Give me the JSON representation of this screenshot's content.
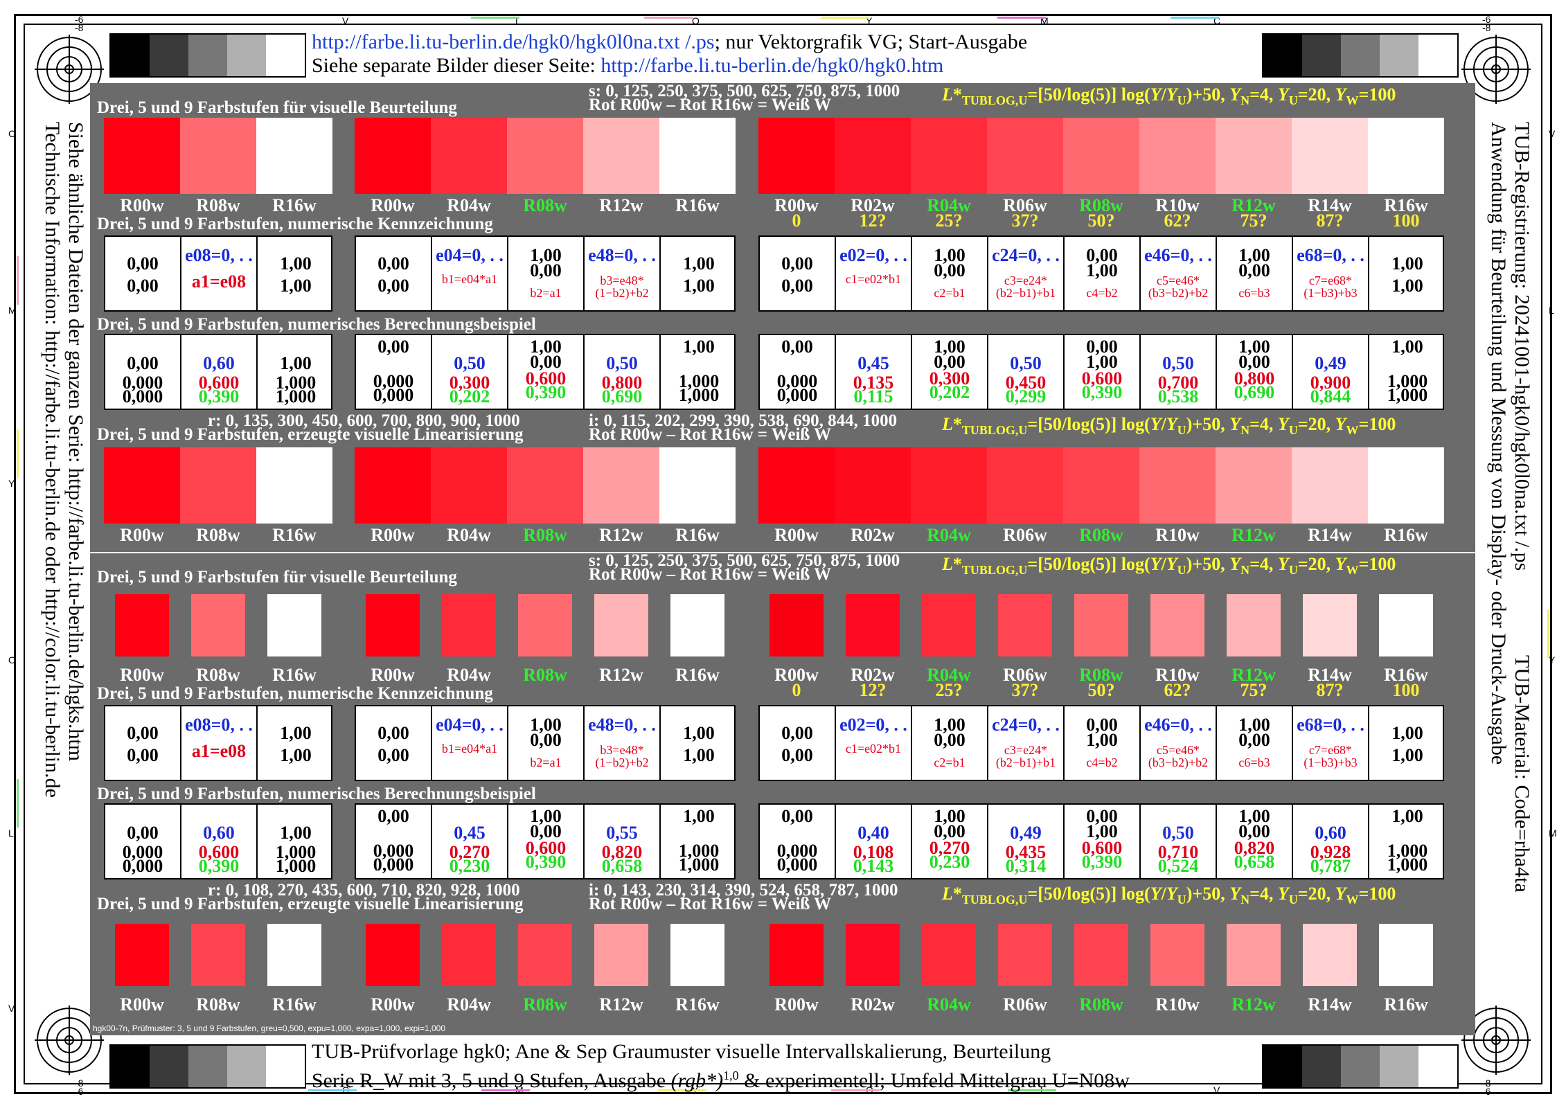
{
  "header": {
    "line1_link": "http://farbe.li.tu-berlin.de/hgk0/hgk0l0na.txt /.ps",
    "line1_rest": "; nur Vektorgrafik VG; Start-Ausgabe",
    "line2_text": "Siehe separate Bilder dieser Seite: ",
    "line2_link": "http://farbe.li.tu-berlin.de/hgk0/hgk0.htm"
  },
  "footer": {
    "line1": "TUB-Prüfvorlage hgk0; Ane & Sep Graumuster visuelle Intervallskalierung, Beurteilung",
    "line2_a": "Serie R_W mit 3, 5 und 9 Stufen, Ausgabe ",
    "line2_rgb": "(rgb*)",
    "line2_sup": "1,0",
    "line2_b": " & experimentell; Umfeld Mittelgrau U=N08w"
  },
  "left_side": {
    "line1": "Siehe ähnliche Dateien der ganzen Serie: http://farbe.li.tu-berlin.de/hgks.htm",
    "line2": "Technische Information: http://farbe.li.tu-berlin.de oder http://color.li.tu-berlin.de"
  },
  "right_side": {
    "line1": "TUB-Registrierung: 20241001-hgk0/hgk0l0na.txt /.ps",
    "line2": "Anwendung für Beurteilung und Messung von Display- oder Druck-Ausgabe",
    "line3": "TUB-Material: Code=rha4ta"
  },
  "edge_letters": {
    "top": [
      "V",
      "L",
      "O",
      "Y",
      "M",
      "C"
    ],
    "top_num_a": "-6",
    "top_num_b": "-8",
    "left": [
      "C",
      "M",
      "Y",
      "O",
      "L",
      "V"
    ],
    "right": [
      "V",
      "L",
      "Y",
      "M"
    ]
  },
  "sections": {
    "visual": "Drei, 5 und 9 Farbstufen für visuelle Beurteilung",
    "numkenn": "Drei, 5 und 9 Farbstufen, numerische Kennzeichnung",
    "berech": "Drei, 5 und 9 Farbstufen, numerisches Berechnungsbeispiel",
    "linear": "Drei, 5 und 9 Farbstufen, erzeugte visuelle Linearisierung",
    "svalues": "s: 0, 125, 250, 375, 500, 625, 750, 875, 1000",
    "rot": "Rot R00w – Rot R16w = Weiß W",
    "formula": "L*TUBLOG,U=[50/log(5)] log(Y/YU)+50, YN=4, YU=20, YW=100",
    "r_top": "r: 0, 135, 300, 450, 600, 700, 800, 900, 1000",
    "i_top": "i: 0, 115, 202, 299, 390, 538, 690, 844, 1000",
    "r_bot": "r: 0, 108, 270, 435, 600, 710, 820, 928, 1000",
    "i_bot": "i: 0, 143, 230, 314, 390, 524, 658, 787, 1000",
    "tiny": "hgk00-7n, Prüfmuster: 3, 5 und 9 Farbstufen, greu=0,500, expu=1,000, expa=1,000, expi=1,000"
  },
  "labels3": [
    "R00w",
    "R08w",
    "R16w"
  ],
  "labels5": [
    "R00w",
    "R04w",
    "R08w",
    "R12w",
    "R16w"
  ],
  "labels9": [
    "R00w",
    "R02w",
    "R04w",
    "R06w",
    "R08w",
    "R10w",
    "R12w",
    "R14w",
    "R16w"
  ],
  "nums9": [
    "0",
    "12?",
    "25?",
    "37?",
    "50?",
    "62?",
    "75?",
    "87?",
    "100"
  ],
  "kenn3": [
    [
      "0,00",
      "0,00"
    ],
    [
      "e08=0, . .",
      "a1=e08"
    ],
    [
      "1,00",
      "1,00"
    ]
  ],
  "kenn5": [
    [
      "0,00",
      "0,00"
    ],
    [
      "e04=0, . .",
      "b1=e04*a1"
    ],
    [
      "1,00",
      "0,00",
      "b2=a1"
    ],
    [
      "e48=0, . .",
      "b3=e48*",
      "(1−b2)+b2"
    ],
    [
      "1,00",
      "1,00"
    ]
  ],
  "kenn9": [
    [
      "0,00",
      "0,00"
    ],
    [
      "e02=0, . .",
      "c1=e02*b1"
    ],
    [
      "1,00",
      "0,00",
      "c2=b1"
    ],
    [
      "c24=0, . .",
      "c3=e24*",
      "(b2−b1)+b1"
    ],
    [
      "0,00",
      "1,00",
      "c4=b2"
    ],
    [
      "e46=0, . .",
      "c5=e46*",
      "(b3−b2)+b2"
    ],
    [
      "1,00",
      "0,00",
      "c6=b3"
    ],
    [
      "e68=0, . .",
      "c7=e68*",
      "(1−b3)+b3"
    ],
    [
      "1,00",
      "1,00"
    ]
  ],
  "ber_top": {
    "b3": [
      [
        "0,00",
        "0,000",
        "0,000"
      ],
      [
        "0,60",
        "0,600",
        "0,390"
      ],
      [
        "1,00",
        "1,000",
        "1,000"
      ]
    ],
    "b5": [
      [
        "0,00",
        "",
        "0,000",
        "0,000"
      ],
      [
        "0,50",
        "",
        "0,300",
        "0,202"
      ],
      [
        "1,00",
        "0,00",
        "0,600",
        "0,390"
      ],
      [
        "0,50",
        "",
        "0,800",
        "0,690"
      ],
      [
        "1,00",
        "",
        "1,000",
        "1,000"
      ]
    ],
    "b9": [
      [
        "0,00",
        "",
        "0,000",
        "0,000"
      ],
      [
        "0,45",
        "",
        "0,135",
        "0,115"
      ],
      [
        "1,00",
        "0,00",
        "0,300",
        "0,202"
      ],
      [
        "0,50",
        "",
        "0,450",
        "0,299"
      ],
      [
        "0,00",
        "1,00",
        "0,600",
        "0,390"
      ],
      [
        "0,50",
        "",
        "0,700",
        "0,538"
      ],
      [
        "1,00",
        "0,00",
        "0,800",
        "0,690"
      ],
      [
        "0,49",
        "",
        "0,900",
        "0,844"
      ],
      [
        "1,00",
        "",
        "1,000",
        "1,000"
      ]
    ]
  },
  "ber_bot": {
    "b3": [
      [
        "0,00",
        "0,000",
        "0,000"
      ],
      [
        "0,60",
        "0,600",
        "0,390"
      ],
      [
        "1,00",
        "1,000",
        "1,000"
      ]
    ],
    "b5": [
      [
        "0,00",
        "",
        "0,000",
        "0,000"
      ],
      [
        "0,45",
        "",
        "0,270",
        "0,230"
      ],
      [
        "1,00",
        "0,00",
        "0,600",
        "0,390"
      ],
      [
        "0,55",
        "",
        "0,820",
        "0,658"
      ],
      [
        "1,00",
        "",
        "1,000",
        "1,000"
      ]
    ],
    "b9": [
      [
        "0,00",
        "",
        "0,000",
        "0,000"
      ],
      [
        "0,40",
        "",
        "0,108",
        "0,143"
      ],
      [
        "1,00",
        "0,00",
        "0,270",
        "0,230"
      ],
      [
        "0,49",
        "",
        "0,435",
        "0,314"
      ],
      [
        "0,00",
        "1,00",
        "0,600",
        "0,390"
      ],
      [
        "0,50",
        "",
        "0,710",
        "0,524"
      ],
      [
        "1,00",
        "0,00",
        "0,820",
        "0,658"
      ],
      [
        "0,60",
        "",
        "0,928",
        "0,787"
      ],
      [
        "1,00",
        "",
        "1,000",
        "1,000"
      ]
    ]
  },
  "colors": {
    "panel": "#6b6b6b",
    "link": "#1a3fd6",
    "yellow": "#ffff33",
    "green": "#33ee33",
    "s3": [
      "#fe0011",
      "#ff6a70",
      "#ffffff"
    ],
    "s5": [
      "#fe0011",
      "#ff2b3a",
      "#ff6a70",
      "#ffb4b6",
      "#ffffff"
    ],
    "s9": [
      "#fe0011",
      "#ff1326",
      "#ff2b3a",
      "#ff4552",
      "#ff6a70",
      "#ff8d91",
      "#ffb4b6",
      "#ffd9da",
      "#ffffff"
    ],
    "l3": [
      "#fe0011",
      "#ff444f",
      "#ffffff"
    ],
    "l5": [
      "#fe0011",
      "#ff1d2c",
      "#ff444f",
      "#ff9ea2",
      "#ffffff"
    ],
    "l9": [
      "#fe0011",
      "#ff0a1c",
      "#ff1d2c",
      "#ff3340",
      "#ff444f",
      "#ff6a71",
      "#ff9ea2",
      "#ffcdd0",
      "#ffffff"
    ],
    "q3": [
      "#fe0011",
      "#ff6a70",
      "#ffffff"
    ],
    "q5": [
      "#fe0011",
      "#ff2b3a",
      "#ff6a70",
      "#ffb4b6",
      "#ffffff"
    ],
    "q9": [
      "#f8000f",
      "#ff0a22",
      "#ff2b3a",
      "#ff4552",
      "#ff6a70",
      "#ff8d91",
      "#ffb4b6",
      "#ffd9da",
      "#ffffff"
    ],
    "m3": [
      "#fe0011",
      "#ff4451",
      "#ffffff"
    ],
    "m5": [
      "#fe0011",
      "#ff2b3a",
      "#ff4451",
      "#ff9da1",
      "#ffffff"
    ],
    "m9": [
      "#fe0011",
      "#ff0a25",
      "#ff2b3a",
      "#ff4552",
      "#ff4451",
      "#ff6a71",
      "#ff9da1",
      "#ffcfd1",
      "#ffffff"
    ]
  }
}
